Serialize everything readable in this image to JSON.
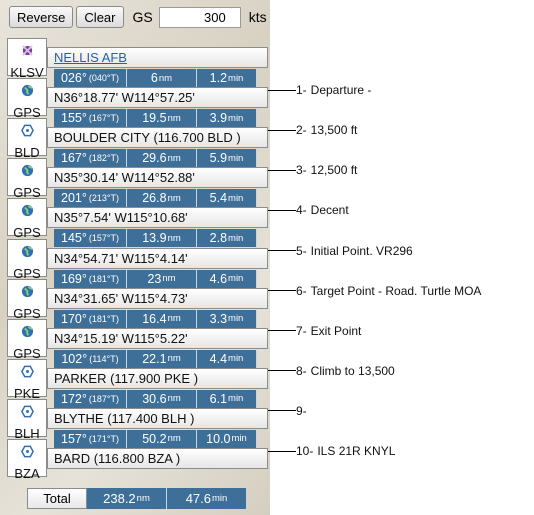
{
  "toolbar": {
    "reverse_label": "Reverse",
    "clear_label": "Clear",
    "gs_label": "GS",
    "gs_value": "300",
    "kts_label": "kts"
  },
  "waypoints": [
    {
      "code": "KLSV",
      "icon": "airport-icon",
      "name": "NELLIS AFB",
      "link": true
    },
    {
      "code": "GPS",
      "icon": "gps-globe-icon",
      "name": "N36°18.77' W114°57.25'"
    },
    {
      "code": "BLD",
      "icon": "vor-icon",
      "name": "BOULDER CITY (116.700 BLD )"
    },
    {
      "code": "GPS",
      "icon": "gps-globe-icon",
      "name": "N35°30.14' W114°52.88'"
    },
    {
      "code": "GPS",
      "icon": "gps-globe-icon",
      "name": "N35°7.54' W115°10.68'"
    },
    {
      "code": "GPS",
      "icon": "gps-globe-icon",
      "name": "N34°54.71' W115°4.14'"
    },
    {
      "code": "GPS",
      "icon": "gps-globe-icon",
      "name": "N34°31.65' W115°4.73'"
    },
    {
      "code": "GPS",
      "icon": "gps-globe-icon",
      "name": "N34°15.19' W115°5.22'"
    },
    {
      "code": "PKE",
      "icon": "vor-icon",
      "name": "PARKER (117.900 PKE )"
    },
    {
      "code": "BLH",
      "icon": "vor-icon",
      "name": "BLYTHE (117.400 BLH )"
    },
    {
      "code": "BZA",
      "icon": "vor-icon",
      "name": "BARD (116.800 BZA )"
    }
  ],
  "legs": [
    {
      "course": "026°",
      "true": "(040°T)",
      "dist": "6",
      "dist_unit": "nm",
      "time": "1.2",
      "time_unit": "min"
    },
    {
      "course": "155°",
      "true": "(167°T)",
      "dist": "19.5",
      "dist_unit": "nm",
      "time": "3.9",
      "time_unit": "min"
    },
    {
      "course": "167°",
      "true": "(182°T)",
      "dist": "29.6",
      "dist_unit": "nm",
      "time": "5.9",
      "time_unit": "min"
    },
    {
      "course": "201°",
      "true": "(213°T)",
      "dist": "26.8",
      "dist_unit": "nm",
      "time": "5.4",
      "time_unit": "min"
    },
    {
      "course": "145°",
      "true": "(157°T)",
      "dist": "13.9",
      "dist_unit": "nm",
      "time": "2.8",
      "time_unit": "min"
    },
    {
      "course": "169°",
      "true": "(181°T)",
      "dist": "23",
      "dist_unit": "nm",
      "time": "4.6",
      "time_unit": "min"
    },
    {
      "course": "170°",
      "true": "(181°T)",
      "dist": "16.4",
      "dist_unit": "nm",
      "time": "3.3",
      "time_unit": "min"
    },
    {
      "course": "102°",
      "true": "(114°T)",
      "dist": "22.1",
      "dist_unit": "nm",
      "time": "4.4",
      "time_unit": "min"
    },
    {
      "course": "172°",
      "true": "(187°T)",
      "dist": "30.6",
      "dist_unit": "nm",
      "time": "6.1",
      "time_unit": "min"
    },
    {
      "course": "157°",
      "true": "(171°T)",
      "dist": "50.2",
      "dist_unit": "nm",
      "time": "10.0",
      "time_unit": "min"
    }
  ],
  "notes": [
    {
      "num": "1-",
      "text": "Departure -"
    },
    {
      "num": "2-",
      "text": "13,500 ft"
    },
    {
      "num": "3-",
      "text": "12,500 ft"
    },
    {
      "num": "4-",
      "text": "Decent"
    },
    {
      "num": "5-",
      "text": "Initial Point. VR296"
    },
    {
      "num": "6-",
      "text": "Target Point - Road.  Turtle MOA"
    },
    {
      "num": "7-",
      "text": "Exit Point"
    },
    {
      "num": "8-",
      "text": "Climb to 13,500"
    },
    {
      "num": "9-",
      "text": ""
    },
    {
      "num": "10-",
      "text": "ILS 21R KNYL"
    }
  ],
  "total": {
    "label": "Total",
    "dist": "238.2",
    "dist_unit": "nm",
    "time": "47.6",
    "time_unit": "min"
  }
}
